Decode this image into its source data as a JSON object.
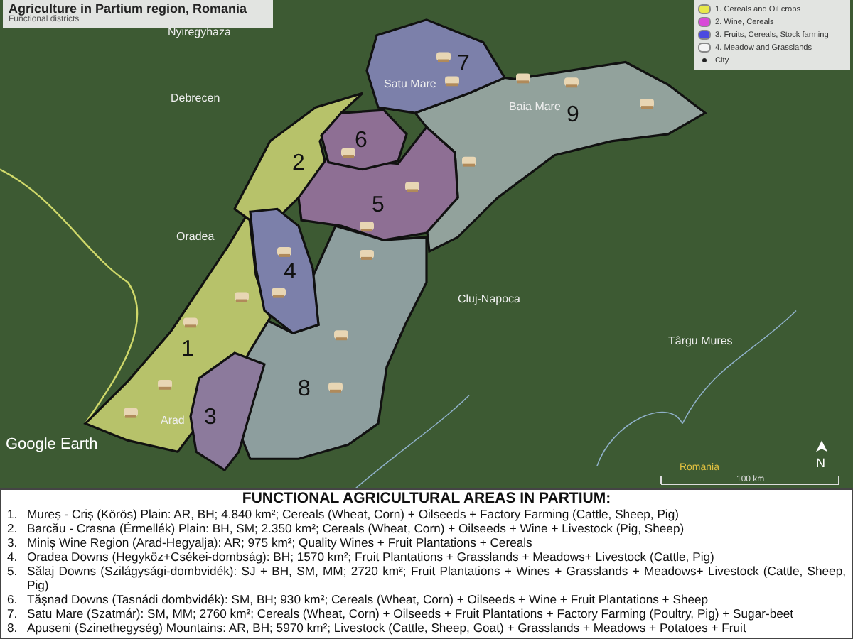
{
  "map": {
    "title": "Agriculture in Partium region, Romania",
    "subtitle": "Functional districts",
    "legend": [
      {
        "label": "1. Cereals and Oil crops",
        "color": "#e8e84a"
      },
      {
        "label": "2. Wine, Cereals",
        "color": "#d84ad8"
      },
      {
        "label": "3. Fruits, Cereals, Stock farming",
        "color": "#4a4ae0"
      },
      {
        "label": "4. Meadow and Grasslands",
        "color": "#f4f4f4"
      },
      {
        "label": "City",
        "color": "#222222"
      }
    ],
    "districts": [
      {
        "number": "1",
        "color": "#b7c26a"
      },
      {
        "number": "2",
        "color": "#b7c26a"
      },
      {
        "number": "3",
        "color": "#8c7a9c"
      },
      {
        "number": "4",
        "color": "#7c80aa"
      },
      {
        "number": "5",
        "color": "#8e6f94"
      },
      {
        "number": "6",
        "color": "#8e6f94"
      },
      {
        "number": "7",
        "color": "#7c80aa"
      },
      {
        "number": "8",
        "color": "#8d9e9e"
      },
      {
        "number": "9",
        "color": "#92a29c"
      }
    ],
    "cities": [
      "Nyiregyhaza",
      "Debrecen",
      "Satu Mare",
      "Baia Mare",
      "Oradea",
      "Cluj-Napoca",
      "Târgu Mures",
      "Arad"
    ],
    "country": "Romania",
    "brand": "Google Earth",
    "scale": "100 km",
    "north": "N"
  },
  "list": {
    "heading": "FUNCTIONAL AGRICULTURAL AREAS IN PARTIUM:",
    "items": [
      {
        "number": "1.",
        "text": "Mureș - Criș (Körös) Plain: AR, BH; 4.840 km²; Cereals (Wheat, Corn) + Oilseeds + Factory Farming (Cattle, Sheep, Pig)"
      },
      {
        "number": "2.",
        "text": "Barcău - Crasna (Érmellék) Plain: BH, SM; 2.350 km²; Cereals (Wheat, Corn) + Oilseeds + Wine + Livestock (Pig, Sheep)"
      },
      {
        "number": "3.",
        "text": "Miniș Wine Region (Arad-Hegyalja): AR; 975 km²; Quality Wines + Fruit Plantations + Cereals"
      },
      {
        "number": "4.",
        "text": "Oradea Downs (Hegyköz+Csékei-dombság): BH; 1570 km²; Fruit Plantations + Grasslands + Meadows+ Livestock (Cattle, Pig)"
      },
      {
        "number": "5.",
        "text": "Sălaj Downs (Szilágysági-dombvidék): SJ + BH, SM, MM; 2720 km²; Fruit Plantations + Wines + Grasslands + Meadows+ Livestock (Cattle, Sheep, Pig)"
      },
      {
        "number": "6.",
        "text": "Tășnad Downs (Tasnádi dombvidék): SM, BH; 930 km²; Cereals (Wheat, Corn) + Oilseeds + Wine + Fruit Plantations + Sheep"
      },
      {
        "number": "7.",
        "text": "Satu Mare (Szatmár): SM, MM; 2760 km²; Cereals (Wheat, Corn) + Oilseeds + Fruit Plantations + Factory Farming (Poultry, Pig) + Sugar-beet"
      },
      {
        "number": "8.",
        "text": "Apuseni (Szinethegység) Mountains: AR, BH; 5970 km²; Livestock (Cattle, Sheep, Goat) + Grasslands + Meadows + Potatoes + Fruit"
      }
    ]
  }
}
